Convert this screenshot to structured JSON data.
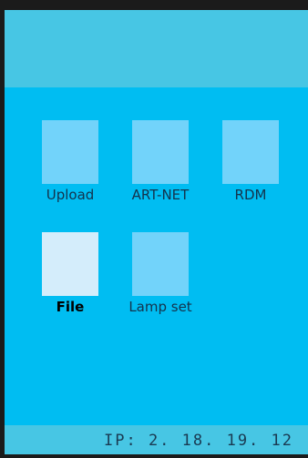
{
  "menu": {
    "items": [
      {
        "label": "Upload",
        "icon": "upload-icon",
        "selected": false
      },
      {
        "label": "ART-NET",
        "icon": "artnet-icon",
        "selected": false
      },
      {
        "label": "RDM",
        "icon": "rdm-icon",
        "selected": false
      },
      {
        "label": "File",
        "icon": "file-icon",
        "selected": true
      },
      {
        "label": "Lamp set",
        "icon": "lamp-set-icon",
        "selected": false
      }
    ]
  },
  "status": {
    "ip": "IP: 2. 18. 19. 12"
  },
  "colors": {
    "screen_bg": "#00bdf2",
    "header_bg": "#47c6e4",
    "tile": "#72d3fa",
    "tile_selected": "#d4edfb"
  }
}
